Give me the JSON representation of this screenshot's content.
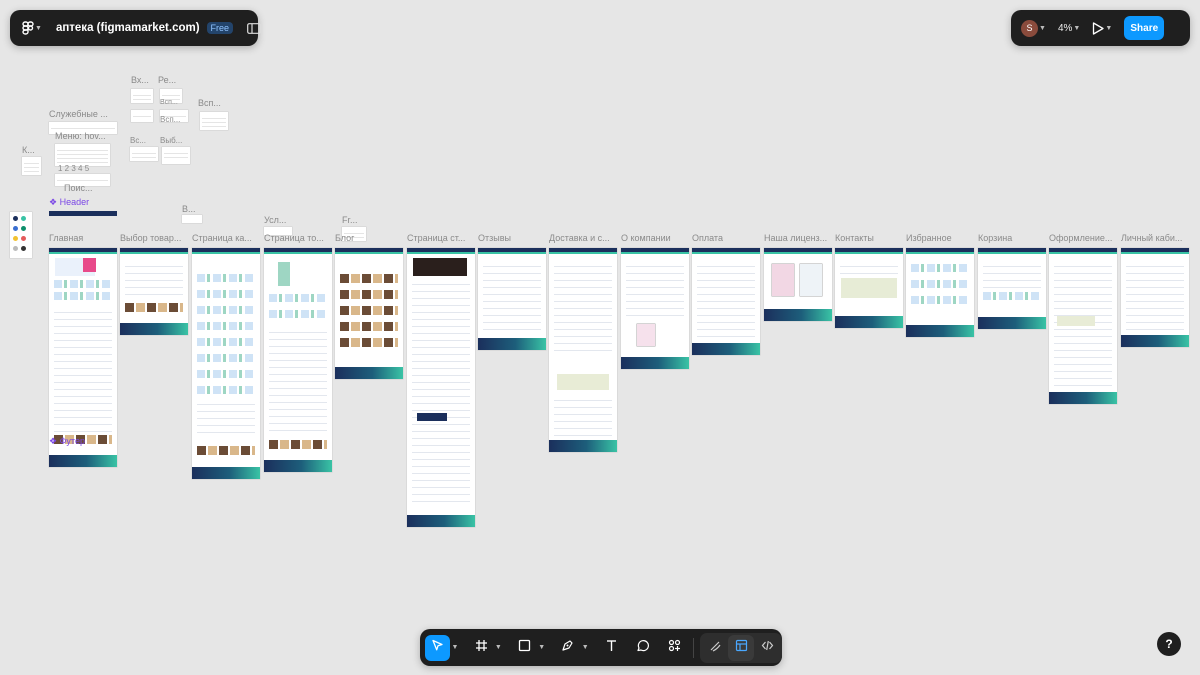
{
  "file": {
    "title": "аптека (figmamarket.com)",
    "plan_badge": "Free"
  },
  "topbar_right": {
    "avatar_letter": "S",
    "zoom": "4%",
    "share_label": "Share"
  },
  "frames": [
    {
      "label": "Главная"
    },
    {
      "label": "Выбор товар..."
    },
    {
      "label": "Страница ка..."
    },
    {
      "label": "Страница то..."
    },
    {
      "label": "Блог"
    },
    {
      "label": "Страница ст..."
    },
    {
      "label": "Отзывы"
    },
    {
      "label": "Доставка и с..."
    },
    {
      "label": "О компании"
    },
    {
      "label": "Оплата"
    },
    {
      "label": "Наша лиценз..."
    },
    {
      "label": "Контакты"
    },
    {
      "label": "Избранное"
    },
    {
      "label": "Корзина"
    },
    {
      "label": "Оформление..."
    },
    {
      "label": "Личный каби..."
    }
  ],
  "small_labels": {
    "vx": "Вх...",
    "re": "Ре...",
    "vsp1": "Всп...",
    "vsp2": "Всп...",
    "vsp3": "Всп...",
    "vyb": "Выб...",
    "vsp_b": "Вс...",
    "service": "Служебные ...",
    "menu": "Меню: hov...",
    "pagination": "1 2 3 4 5",
    "search": "Поис...",
    "k": "К...",
    "v2": "В...",
    "usl": "Усл...",
    "fr": "Fr...",
    "header_component": "Header",
    "footer_component": "Футер"
  },
  "colors": {
    "accent": "#0d99ff",
    "component": "#7b47e6",
    "navy": "#1b2f5c",
    "teal": "#39c3a5"
  }
}
